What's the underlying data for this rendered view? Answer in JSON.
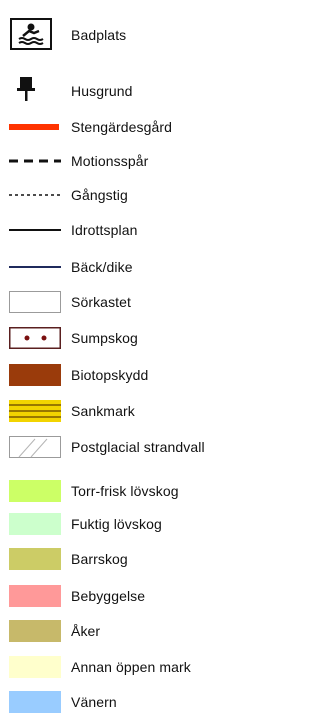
{
  "legend": {
    "items": [
      {
        "label": "Badplats",
        "symbol": "swimmer-icon"
      },
      {
        "label": "Husgrund",
        "symbol": "pin-icon"
      },
      {
        "label": "Stengärdesgård",
        "symbol": "thick-red-line",
        "color": "#ff3300"
      },
      {
        "label": "Motionsspår",
        "symbol": "dashed-line",
        "color": "#111111"
      },
      {
        "label": "Gångstig",
        "symbol": "dotted-line",
        "color": "#111111"
      },
      {
        "label": "Idrottsplan",
        "symbol": "thin-line",
        "color": "#111111"
      },
      {
        "label": "Bäck/dike",
        "symbol": "thin-line-blue",
        "color": "#1f2a5c"
      },
      {
        "label": "Sörkastet",
        "symbol": "outlined-box",
        "color": "#ffffff",
        "border": "#9b9b9b"
      },
      {
        "label": "Sumpskog",
        "symbol": "dots-box",
        "color": "#ffffff",
        "border": "#5a1f1f",
        "dot": "#7a1010"
      },
      {
        "label": "Biotopskydd",
        "symbol": "fill-box",
        "color": "#9a3b0b"
      },
      {
        "label": "Sankmark",
        "symbol": "striped-box",
        "color": "#f2d400",
        "stripe": "#7a5a00"
      },
      {
        "label": "Postglacial strandvall",
        "symbol": "hatched-box",
        "color": "#ffffff",
        "border": "#9b9b9b"
      },
      {
        "label": "Torr-frisk lövskog",
        "symbol": "fill-box",
        "color": "#ccff66"
      },
      {
        "label": "Fuktig lövskog",
        "symbol": "fill-box",
        "color": "#ccffcc"
      },
      {
        "label": "Barrskog",
        "symbol": "fill-box",
        "color": "#cccc66"
      },
      {
        "label": "Bebyggelse",
        "symbol": "fill-box",
        "color": "#ff9999"
      },
      {
        "label": "Åker",
        "symbol": "fill-box",
        "color": "#c7b96a"
      },
      {
        "label": "Annan öppen mark",
        "symbol": "fill-box",
        "color": "#ffffcc"
      },
      {
        "label": "Vänern",
        "symbol": "fill-box",
        "color": "#99ccff"
      }
    ]
  }
}
